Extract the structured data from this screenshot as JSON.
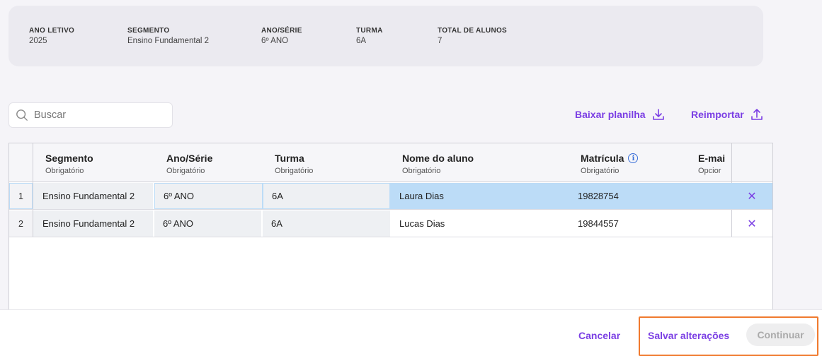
{
  "summary": {
    "ano_letivo": {
      "label": "ANO LETIVO",
      "value": "2025"
    },
    "segmento": {
      "label": "SEGMENTO",
      "value": "Ensino Fundamental 2"
    },
    "ano_serie": {
      "label": "ANO/SÉRIE",
      "value": "6º ANO"
    },
    "turma": {
      "label": "TURMA",
      "value": "6A"
    },
    "total": {
      "label": "TOTAL DE ALUNOS",
      "value": "7"
    }
  },
  "search": {
    "placeholder": "Buscar"
  },
  "actions": {
    "download_label": "Baixar planilha",
    "reimport_label": "Reimportar"
  },
  "table": {
    "columns": [
      {
        "title": "Segmento",
        "subtitle": "Obrigatório"
      },
      {
        "title": "Ano/Série",
        "subtitle": "Obrigatório"
      },
      {
        "title": "Turma",
        "subtitle": "Obrigatório"
      },
      {
        "title": "Nome do aluno",
        "subtitle": "Obrigatório"
      },
      {
        "title": "Matrícula",
        "subtitle": "Obrigatório"
      },
      {
        "title": "E-mai",
        "subtitle": "Opcior"
      }
    ],
    "rows": [
      {
        "num": "1",
        "segmento": "Ensino Fundamental 2",
        "ano": "6º ANO",
        "turma": "6A",
        "nome": "Laura Dias",
        "matricula": "19828754"
      },
      {
        "num": "2",
        "segmento": "Ensino Fundamental 2",
        "ano": "6º ANO",
        "turma": "6A",
        "nome": "Lucas Dias",
        "matricula": "19844557"
      }
    ],
    "delete_glyph": "✕"
  },
  "footer": {
    "cancel_label": "Cancelar",
    "save_label": "Salvar alterações",
    "continue_label": "Continuar"
  },
  "colors": {
    "accent": "#7b3fe4",
    "highlight": "#f07a2e",
    "selected_row": "#bcdcf7"
  }
}
